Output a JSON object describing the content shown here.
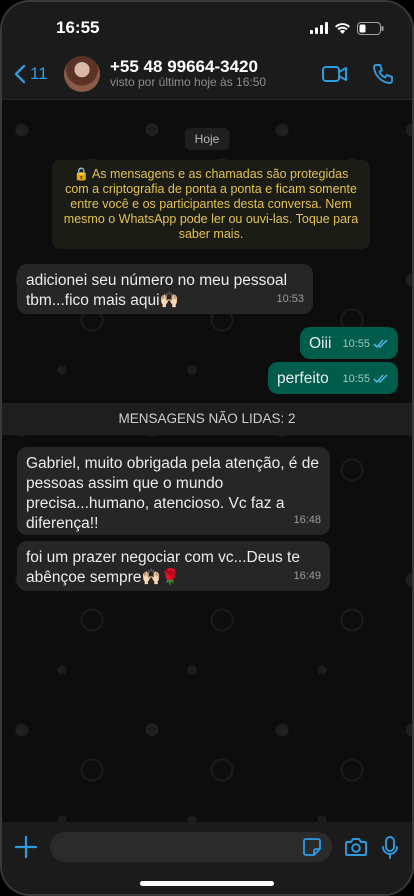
{
  "status_bar": {
    "time": "16:55"
  },
  "header": {
    "back_count": "11",
    "contact_name": "+55 48 99664-3420",
    "contact_status": "visto por último hoje às 16:50"
  },
  "chat": {
    "date_label": "Hoje",
    "system_message": "🔒 As mensagens e as chamadas são protegidas com a criptografia de ponta a ponta e ficam somente entre você e os participantes desta conversa. Nem mesmo o WhatsApp pode ler ou ouvi-las. Toque para saber mais.",
    "unread_banner": "MENSAGENS NÃO LIDAS: 2",
    "messages": [
      {
        "direction": "in",
        "text": "adicionei seu número no meu pessoal tbm...fico mais aqui🙌🏻",
        "time": "10:53"
      },
      {
        "direction": "out",
        "text": "Oiii",
        "time": "10:55"
      },
      {
        "direction": "out",
        "text": "perfeito",
        "time": "10:55"
      },
      {
        "direction": "in",
        "text": "Gabriel, muito obrigada pela atenção, é de pessoas assim que o mundo precisa...humano,  atencioso. Vc faz a diferença!!",
        "time": "16:48"
      },
      {
        "direction": "in",
        "text": "foi um prazer negociar com vc...Deus te abênçoe sempre🙌🏻🌹",
        "time": "16:49"
      }
    ]
  },
  "colors": {
    "accent": "#2f9bdf",
    "outgoing_bubble": "#005c4b",
    "incoming_bubble": "#262626",
    "read_ticks": "#53bdeb"
  }
}
